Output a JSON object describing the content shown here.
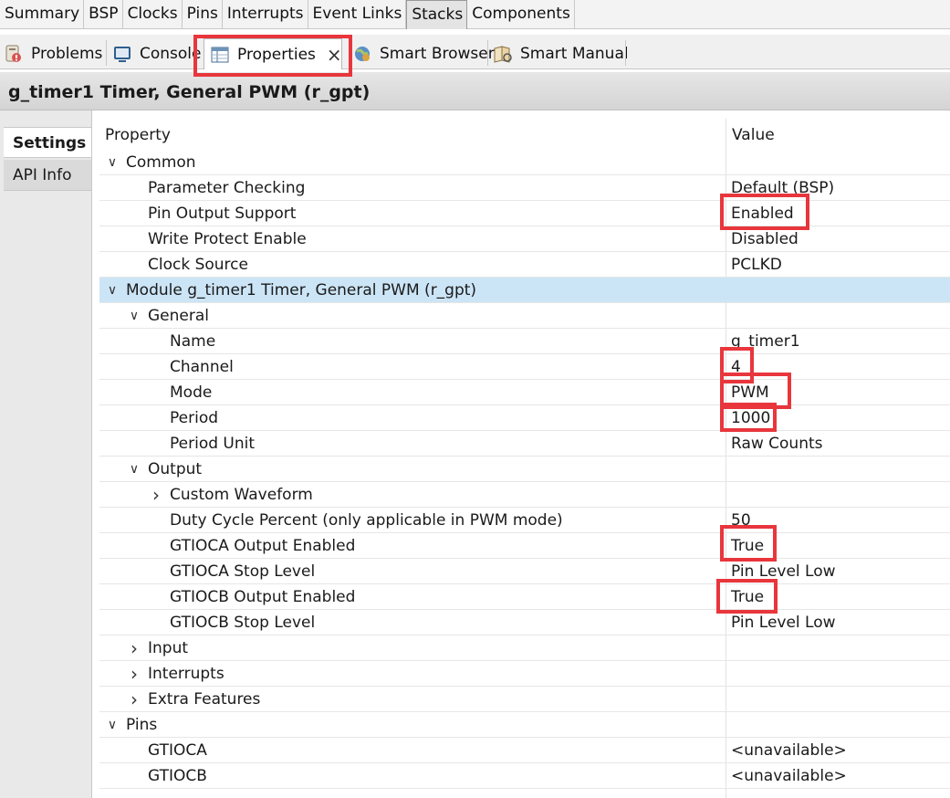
{
  "top_tabs": [
    "Summary",
    "BSP",
    "Clocks",
    "Pins",
    "Interrupts",
    "Event Links",
    "Stacks",
    "Components"
  ],
  "top_tab_active": "Stacks",
  "view_tabs": {
    "problems": "Problems",
    "console": "Console",
    "properties": "Properties",
    "smart_browser": "Smart Browser",
    "smart_manual": "Smart Manual"
  },
  "heading": "g_timer1 Timer, General PWM (r_gpt)",
  "side_tabs": {
    "settings": "Settings",
    "api_info": "API Info"
  },
  "columns": {
    "property": "Property",
    "value": "Value"
  },
  "rows": [
    {
      "label": "Common",
      "value": "",
      "level": 0,
      "expander": "open"
    },
    {
      "label": "Parameter Checking",
      "value": "Default (BSP)",
      "level": 1,
      "expander": "none"
    },
    {
      "label": "Pin Output Support",
      "value": "Enabled",
      "level": 1,
      "expander": "none"
    },
    {
      "label": "Write Protect Enable",
      "value": "Disabled",
      "level": 1,
      "expander": "none"
    },
    {
      "label": "Clock Source",
      "value": "PCLKD",
      "level": 1,
      "expander": "none"
    },
    {
      "label": "Module g_timer1 Timer, General PWM (r_gpt)",
      "value": "",
      "level": 0,
      "expander": "open",
      "selected": true
    },
    {
      "label": "General",
      "value": "",
      "level": 1,
      "expander": "open"
    },
    {
      "label": "Name",
      "value": "g_timer1",
      "level": 2,
      "expander": "none"
    },
    {
      "label": "Channel",
      "value": "4",
      "level": 2,
      "expander": "none"
    },
    {
      "label": "Mode",
      "value": "PWM",
      "level": 2,
      "expander": "none"
    },
    {
      "label": "Period",
      "value": "1000",
      "level": 2,
      "expander": "none"
    },
    {
      "label": "Period Unit",
      "value": "Raw Counts",
      "level": 2,
      "expander": "none"
    },
    {
      "label": "Output",
      "value": "",
      "level": 1,
      "expander": "open"
    },
    {
      "label": "Custom Waveform",
      "value": "",
      "level": 2,
      "expander": "closed"
    },
    {
      "label": "Duty Cycle Percent (only applicable in PWM mode)",
      "value": "50",
      "level": 2,
      "expander": "none"
    },
    {
      "label": "GTIOCA Output Enabled",
      "value": "True",
      "level": 2,
      "expander": "none"
    },
    {
      "label": "GTIOCA Stop Level",
      "value": "Pin Level Low",
      "level": 2,
      "expander": "none"
    },
    {
      "label": "GTIOCB Output Enabled",
      "value": "True",
      "level": 2,
      "expander": "none"
    },
    {
      "label": "GTIOCB Stop Level",
      "value": "Pin Level Low",
      "level": 2,
      "expander": "none"
    },
    {
      "label": "Input",
      "value": "",
      "level": 1,
      "expander": "closed"
    },
    {
      "label": "Interrupts",
      "value": "",
      "level": 1,
      "expander": "closed"
    },
    {
      "label": "Extra Features",
      "value": "",
      "level": 1,
      "expander": "closed"
    },
    {
      "label": "Pins",
      "value": "",
      "level": 0,
      "expander": "open"
    },
    {
      "label": "GTIOCA",
      "value": "<unavailable>",
      "level": 1,
      "expander": "none"
    },
    {
      "label": "GTIOCB",
      "value": "<unavailable>",
      "level": 1,
      "expander": "none"
    }
  ],
  "highlight_color": "#e8363c",
  "selection_color": "#cce5f6"
}
